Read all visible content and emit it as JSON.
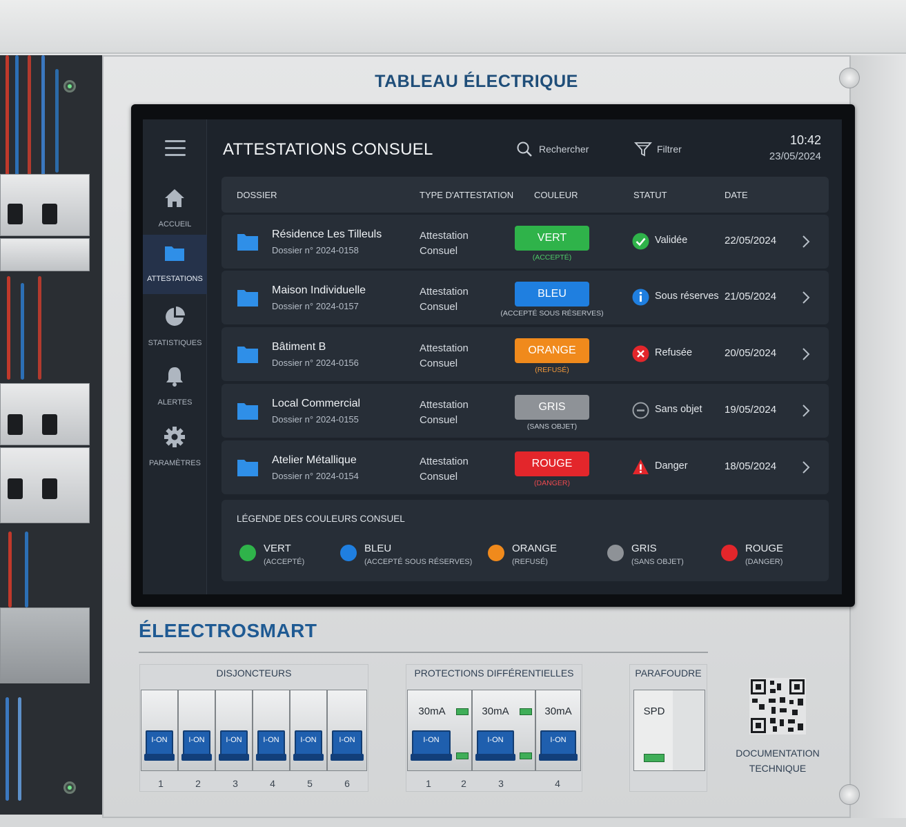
{
  "panel": {
    "title": "TABLEAU ÉLECTRIQUE"
  },
  "app": {
    "title": "ATTESTATIONS CONSUEL",
    "search_label": "Rechercher",
    "filter_label": "Filtrer",
    "time": "10:42",
    "date": "23/05/2024"
  },
  "sidebar": {
    "items": [
      {
        "label": "ACCUEIL",
        "icon": "home-icon"
      },
      {
        "label": "ATTESTATIONS",
        "icon": "folder-icon",
        "active": true
      },
      {
        "label": "STATISTIQUES",
        "icon": "pie-chart-icon"
      },
      {
        "label": "ALERTES",
        "icon": "bell-icon"
      },
      {
        "label": "PARAMÈTRES",
        "icon": "gear-icon"
      }
    ]
  },
  "table": {
    "headers": [
      "DOSSIER",
      "TYPE D'ATTESTATION",
      "COULEUR",
      "STATUT",
      "DATE"
    ],
    "rows": [
      {
        "name": "Résidence Les Tilleuls",
        "number": "Dossier n° 2024-0158",
        "type_line1": "Attestation",
        "type_line2": "Consuel",
        "color_label": "VERT",
        "color_sub": "(ACCEPTÉ)",
        "color": "#2fb34a",
        "status": "Validée",
        "status_icon": "check-circle-icon",
        "date": "22/05/2024"
      },
      {
        "name": "Maison Individuelle",
        "number": "Dossier n° 2024-0157",
        "type_line1": "Attestation",
        "type_line2": "Consuel",
        "color_label": "BLEU",
        "color_sub": "(ACCEPTÉ SOUS RÉSERVES)",
        "color": "#1f7fe0",
        "status": "Sous réserves",
        "status_icon": "info-circle-icon",
        "date": "21/05/2024"
      },
      {
        "name": "Bâtiment B",
        "number": "Dossier n° 2024-0156",
        "type_line1": "Attestation",
        "type_line2": "Consuel",
        "color_label": "ORANGE",
        "color_sub": "(REFUSÉ)",
        "color": "#f08a1c",
        "status": "Refusée",
        "status_icon": "x-circle-icon",
        "date": "20/05/2024"
      },
      {
        "name": "Local Commercial",
        "number": "Dossier n° 2024-0155",
        "type_line1": "Attestation",
        "type_line2": "Consuel",
        "color_label": "GRIS",
        "color_sub": "(SANS OBJET)",
        "color": "#8e9297",
        "status": "Sans objet",
        "status_icon": "minus-circle-icon",
        "date": "19/05/2024"
      },
      {
        "name": "Atelier Métallique",
        "number": "Dossier n° 2024-0154",
        "type_line1": "Attestation",
        "type_line2": "Consuel",
        "color_label": "ROUGE",
        "color_sub": "(DANGER)",
        "color": "#e3262b",
        "status": "Danger",
        "status_icon": "warning-triangle-icon",
        "date": "18/05/2024"
      }
    ]
  },
  "legend": {
    "title": "LÉGENDE DES COULEURS CONSUEL",
    "items": [
      {
        "name": "VERT",
        "sub": "(ACCEPTÉ)",
        "color": "#2fb34a"
      },
      {
        "name": "BLEU",
        "sub": "(ACCEPTÉ SOUS RÉSERVES)",
        "color": "#1f7fe0"
      },
      {
        "name": "ORANGE",
        "sub": "(REFUSÉ)",
        "color": "#f08a1c"
      },
      {
        "name": "GRIS",
        "sub": "(SANS OBJET)",
        "color": "#8e9297"
      },
      {
        "name": "ROUGE",
        "sub": "(DANGER)",
        "color": "#e3262b"
      }
    ]
  },
  "brand": {
    "name": "ÉLEECTROSMART"
  },
  "hardware": {
    "disjoncteurs": {
      "title": "DISJONCTEURS",
      "lever_label": "I-ON",
      "numbers": [
        "1",
        "2",
        "3",
        "4",
        "5",
        "6"
      ]
    },
    "differentielles": {
      "title": "PROTECTIONS DIFFÉRENTIELLES",
      "rating": "30mA",
      "lever_label": "I-ON",
      "numbers": [
        "1",
        "2",
        "3",
        "4"
      ]
    },
    "parafoudre": {
      "title": "PARAFOUDRE",
      "label": "SPD"
    },
    "documentation": {
      "line1": "DOCUMENTATION",
      "line2": "TECHNIQUE"
    }
  }
}
